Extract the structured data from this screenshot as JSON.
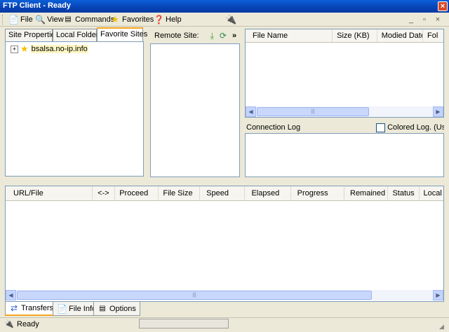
{
  "window": {
    "title": "FTP Client - Ready"
  },
  "menu": {
    "items": [
      {
        "label": "File",
        "icon": "file-icon"
      },
      {
        "label": "View",
        "icon": "view-icon"
      },
      {
        "label": "Commands",
        "icon": "commands-icon"
      },
      {
        "label": "Favorites",
        "icon": "favorites-star-icon"
      },
      {
        "label": "Help",
        "icon": "help-icon"
      }
    ]
  },
  "left_panel": {
    "tabs": [
      "Site Properties",
      "Local Folders",
      "Favorite Sites"
    ],
    "active_tab": "Favorite Sites",
    "tree": [
      {
        "label": "bsalsa.no-ip.info"
      }
    ]
  },
  "remote_panel": {
    "label": "Remote Site:",
    "more": "»"
  },
  "file_list": {
    "columns": [
      "File Name",
      "Size (KB)",
      "Modied Date",
      "Fol"
    ]
  },
  "connection_log": {
    "title": "Connection Log",
    "colored_log_label": "Colored Log. (Uses som"
  },
  "transfers": {
    "columns": [
      "URL/File",
      "<->",
      "Proceed",
      "File Size",
      "Speed",
      "Elapsed",
      "Progress",
      "Remained",
      "Status",
      "Local I"
    ]
  },
  "bottom_tabs": [
    {
      "label": "Transfers",
      "icon": "transfers-icon"
    },
    {
      "label": "File Info",
      "icon": "file-info-icon"
    },
    {
      "label": "Options",
      "icon": "options-icon"
    }
  ],
  "status": {
    "text": "Ready"
  }
}
